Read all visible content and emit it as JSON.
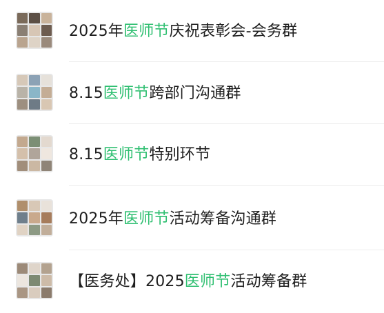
{
  "colors": {
    "highlight": "#2fbf71",
    "text": "#1f1f1f",
    "divider": "#ececec"
  },
  "groups": [
    {
      "prefix": "2025年",
      "highlight": "医师节",
      "suffix": "庆祝表彰会-会务群",
      "avatar_tiles": [
        "#7a6a5a",
        "#5c4f45",
        "#c9b39b",
        "#8a7f74",
        "#d7c6b5",
        "#6d5c50",
        "#b9a48f",
        "#ded3c6",
        "#9a8a7c"
      ]
    },
    {
      "prefix": "8.15",
      "highlight": "医师节",
      "suffix": "跨部门沟通群",
      "avatar_tiles": [
        "#d6c8b8",
        "#8ca2b5",
        "#e6e1da",
        "#b9b3a8",
        "#8ab6c8",
        "#c4ad95",
        "#9d8f80",
        "#6e7b86",
        "#d9c7b3"
      ]
    },
    {
      "prefix": "8.15",
      "highlight": "医师节",
      "suffix": "特别环节",
      "avatar_tiles": [
        "#c3a98f",
        "#7c8f75",
        "#e3d9cf",
        "#d4c0ab",
        "#b0a59a",
        "#efe7df",
        "#a18e7b",
        "#cbb8a3",
        "#8f8477"
      ]
    },
    {
      "prefix": "2025年",
      "highlight": "医师节",
      "suffix": "活动筹备沟通群",
      "avatar_tiles": [
        "#b08f6c",
        "#d8c8b6",
        "#e9e2da",
        "#6f7f8c",
        "#c9a98c",
        "#a67c5c",
        "#e0d3c4",
        "#8d9a84",
        "#c1ae9a"
      ]
    },
    {
      "prefix": "【医务处】2025",
      "highlight": "医师节",
      "suffix": "活动筹备群",
      "avatar_tiles": [
        "#9c8a78",
        "#dfd5ca",
        "#b3a28f",
        "#ece6df",
        "#7d8a73",
        "#cdbba8",
        "#a99684",
        "#d9ccbe",
        "#8b7b6c"
      ]
    }
  ]
}
